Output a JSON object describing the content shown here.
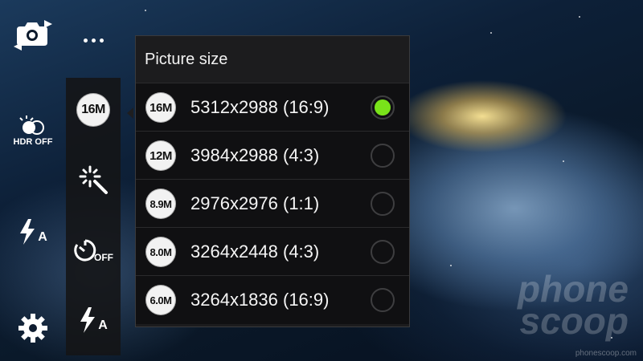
{
  "left_rail": {
    "hdr_label": "HDR OFF",
    "flash_label": "A"
  },
  "quick_strip": {
    "current_size": "16M",
    "timer_label": "OFF",
    "flash_label": "A"
  },
  "picture_size": {
    "title": "Picture size",
    "options": [
      {
        "badge": "16M",
        "label": "5312x2988 (16:9)",
        "selected": true
      },
      {
        "badge": "12M",
        "label": "3984x2988 (4:3)",
        "selected": false
      },
      {
        "badge": "8.9M",
        "label": "2976x2976 (1:1)",
        "selected": false
      },
      {
        "badge": "8.0M",
        "label": "3264x2448 (4:3)",
        "selected": false
      },
      {
        "badge": "6.0M",
        "label": "3264x1836 (16:9)",
        "selected": false
      }
    ]
  },
  "watermark": {
    "line1": "phone",
    "line2": "scoop",
    "url": "phonescoop.com"
  },
  "colors": {
    "selected_radio": "#79e21a",
    "popup_bg": "#1c1c1e"
  }
}
